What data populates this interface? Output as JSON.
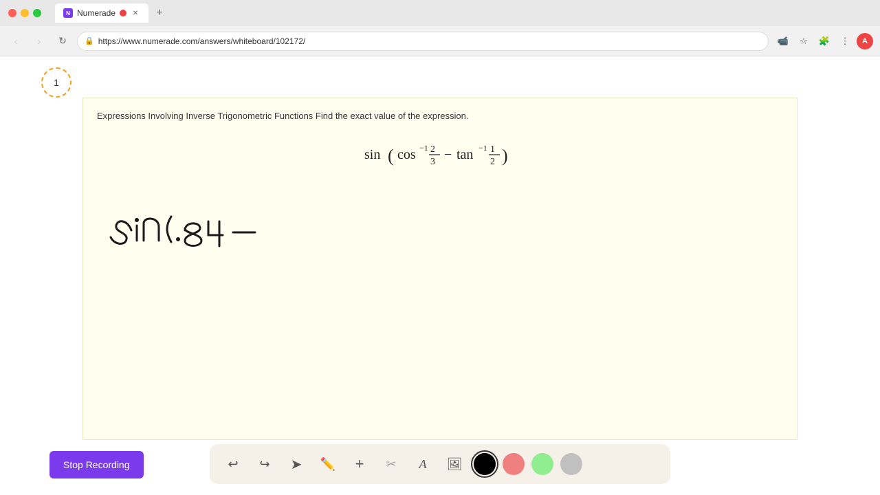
{
  "browser": {
    "tab_title": "Numerade",
    "tab_favicon_label": "N",
    "url": "https://www.numerade.com/answers/whiteboard/102172/",
    "new_tab_label": "+",
    "nav": {
      "back_label": "‹",
      "forward_label": "›",
      "refresh_label": "↻"
    }
  },
  "page": {
    "counter": "1",
    "problem_text": "Expressions Involving Inverse Trigonometric Functions Find the exact value of the expression.",
    "math_formula_display": "sin(cos⁻¹ 2/3 − tan⁻¹ 1/2)"
  },
  "toolbar_bottom": {
    "undo_label": "↩",
    "redo_label": "↪",
    "select_icon": "select",
    "pencil_icon": "pencil",
    "plus_icon": "plus",
    "eraser_icon": "eraser",
    "text_icon": "text",
    "image_icon": "image",
    "colors": [
      "#000000",
      "#f08080",
      "#90ee90",
      "#c0c0c0"
    ]
  },
  "stop_recording": {
    "label": "Stop Recording"
  }
}
